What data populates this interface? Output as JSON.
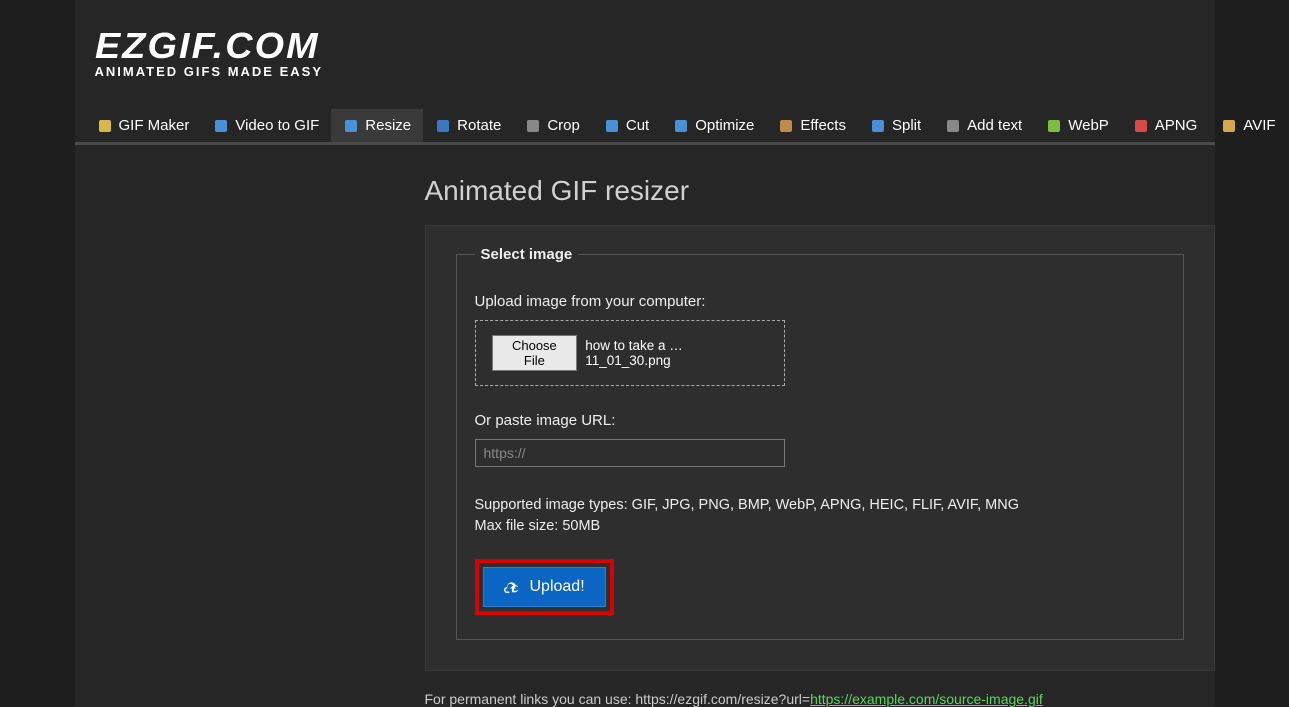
{
  "logo": {
    "main": "EZGIF.COM",
    "sub": "ANIMATED GIFS MADE EASY"
  },
  "nav": [
    {
      "label": "GIF Maker",
      "icon": "gif-maker-icon",
      "active": false
    },
    {
      "label": "Video to GIF",
      "icon": "video-to-gif-icon",
      "active": false
    },
    {
      "label": "Resize",
      "icon": "resize-icon",
      "active": true
    },
    {
      "label": "Rotate",
      "icon": "rotate-icon",
      "active": false
    },
    {
      "label": "Crop",
      "icon": "crop-icon",
      "active": false
    },
    {
      "label": "Cut",
      "icon": "cut-icon",
      "active": false
    },
    {
      "label": "Optimize",
      "icon": "optimize-icon",
      "active": false
    },
    {
      "label": "Effects",
      "icon": "effects-icon",
      "active": false
    },
    {
      "label": "Split",
      "icon": "split-icon",
      "active": false
    },
    {
      "label": "Add text",
      "icon": "add-text-icon",
      "active": false
    },
    {
      "label": "WebP",
      "icon": "webp-icon",
      "active": false
    },
    {
      "label": "APNG",
      "icon": "apng-icon",
      "active": false
    },
    {
      "label": "AVIF",
      "icon": "avif-icon",
      "active": false
    }
  ],
  "title": "Animated GIF resizer",
  "form": {
    "legend": "Select image",
    "upload_label": "Upload image from your computer:",
    "choose_file_label": "Choose File",
    "chosen_file_name": "how to take a … 11_01_30.png",
    "url_label": "Or paste image URL:",
    "url_placeholder": "https://",
    "url_value": "",
    "supported_line": "Supported image types: GIF, JPG, PNG, BMP, WebP, APNG, HEIC, FLIF, AVIF, MNG",
    "maxsize_line": "Max file size: 50MB",
    "upload_button": "Upload!"
  },
  "footer_hint_prefix": "For permanent links you can use: https://ezgif.com/resize?url=",
  "footer_hint_link": "https://example.com/source-image.gif",
  "icon_colors": {
    "gif-maker-icon": "#d6b84a",
    "video-to-gif-icon": "#4a90d6",
    "resize-icon": "#4a90d6",
    "rotate-icon": "#3a78c2",
    "crop-icon": "#888888",
    "cut-icon": "#4a90d6",
    "optimize-icon": "#4a90d6",
    "effects-icon": "#c08a4a",
    "split-icon": "#4a90d6",
    "add-text-icon": "#888888",
    "webp-icon": "#7bbf3f",
    "apng-icon": "#d84a4a",
    "avif-icon": "#d6a64a"
  }
}
